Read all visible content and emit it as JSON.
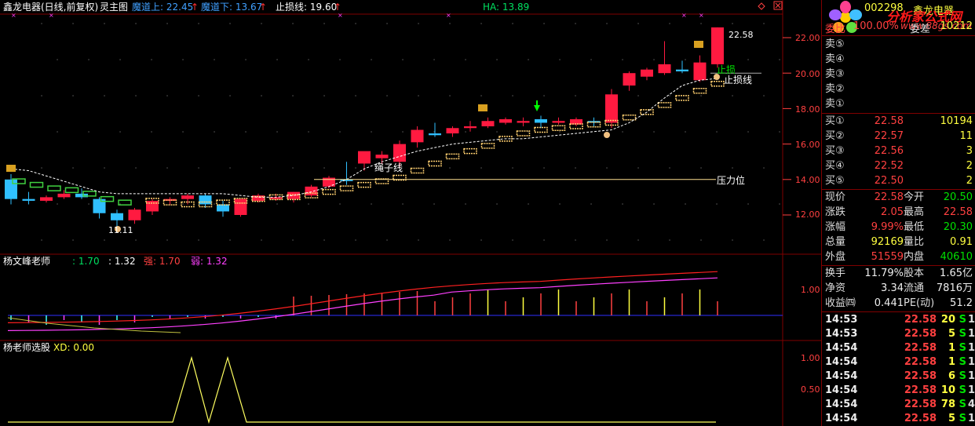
{
  "header": {
    "stock_name": "鑫龙电器(日线,前复权)",
    "main_chart": "灵主图",
    "upper_label": "魔道上: 22.45",
    "lower_label": "魔道下: 13.67",
    "stop_label": "止损线: 19.60",
    "ha_label": "HA: 13.89"
  },
  "panel2_header": {
    "title": "杨文峰老师",
    "v1": ": 1.70",
    "v2": ": 1.32",
    "strong": "强: 1.70",
    "weak": "弱: 1.32"
  },
  "panel3_header": {
    "title": "杨老师选股",
    "xd": "XD: 0.00"
  },
  "annotations": {
    "high_price": "22.58",
    "low_price": "11.11",
    "stop_text": "止损",
    "stop_line_text": "止损线",
    "pressure_text": "压力位",
    "rope_text": "绳子线"
  },
  "axis": {
    "main": [
      "22.00",
      "20.00",
      "18.00",
      "16.00",
      "14.00",
      "12.00"
    ],
    "mid": [
      "1.00"
    ],
    "low": [
      "1.00",
      "0.50"
    ]
  },
  "quote": {
    "code": "002298",
    "name": "鑫龙电器",
    "watermark": "分析家公式网",
    "watermark_url": "www.88gs.com",
    "weibi_label": "委比",
    "weibi": "100.00%",
    "weicha_label": "委差",
    "weicha": "10212",
    "sell": [
      {
        "label": "卖⑤",
        "price": "",
        "vol": ""
      },
      {
        "label": "卖④",
        "price": "",
        "vol": ""
      },
      {
        "label": "卖③",
        "price": "",
        "vol": ""
      },
      {
        "label": "卖②",
        "price": "",
        "vol": ""
      },
      {
        "label": "卖①",
        "price": "",
        "vol": ""
      }
    ],
    "buy": [
      {
        "label": "买①",
        "price": "22.58",
        "vol": "10194"
      },
      {
        "label": "买②",
        "price": "22.57",
        "vol": "11"
      },
      {
        "label": "买③",
        "price": "22.56",
        "vol": "3"
      },
      {
        "label": "买④",
        "price": "22.52",
        "vol": "2"
      },
      {
        "label": "买⑤",
        "price": "22.50",
        "vol": "2"
      }
    ],
    "stats": [
      {
        "l1": "现价",
        "v1": "22.58",
        "l2": "今开",
        "v2": "20.50"
      },
      {
        "l1": "涨跌",
        "v1": "2.05",
        "l2": "最高",
        "v2": "22.58"
      },
      {
        "l1": "涨幅",
        "v1": "9.99%",
        "l2": "最低",
        "v2": "20.30"
      },
      {
        "l1": "总量",
        "v1": "92169",
        "l2": "量比",
        "v2": "0.91"
      },
      {
        "l1": "外盘",
        "v1": "51559",
        "l2": "内盘",
        "v2": "40610"
      }
    ],
    "finance": [
      {
        "l1": "换手",
        "v1": "11.79%",
        "l2": "股本",
        "v2": "1.65亿"
      },
      {
        "l1": "净资",
        "v1": "3.34",
        "l2": "流通",
        "v2": "7816万"
      },
      {
        "l1": "收益㈣",
        "v1": "0.441",
        "l2": "PE(动)",
        "v2": "51.2"
      }
    ],
    "ticks": [
      {
        "time": "14:53",
        "price": "22.58",
        "vol": "20",
        "bs": "S",
        "n": "1"
      },
      {
        "time": "14:53",
        "price": "22.58",
        "vol": "5",
        "bs": "S",
        "n": "1"
      },
      {
        "time": "14:54",
        "price": "22.58",
        "vol": "1",
        "bs": "S",
        "n": "1"
      },
      {
        "time": "14:54",
        "price": "22.58",
        "vol": "1",
        "bs": "S",
        "n": "1"
      },
      {
        "time": "14:54",
        "price": "22.58",
        "vol": "6",
        "bs": "S",
        "n": "1"
      },
      {
        "time": "14:54",
        "price": "22.58",
        "vol": "10",
        "bs": "S",
        "n": "1"
      },
      {
        "time": "14:54",
        "price": "22.58",
        "vol": "78",
        "bs": "S",
        "n": "4"
      },
      {
        "time": "14:54",
        "price": "22.58",
        "vol": "5",
        "bs": "S",
        "n": "1"
      }
    ]
  },
  "colors": {
    "up": "#ff1a40",
    "down": "#30c0ff",
    "grid": "#800000",
    "upper_band": "#ffd070",
    "stop": "#ffffff",
    "line_red": "#ff2020",
    "line_purple": "#ff40ff",
    "line_yellow": "#ffff60"
  },
  "chart_data": {
    "type": "candlestick",
    "ylim": [
      11.0,
      23.0
    ],
    "candles": [
      {
        "o": 14.0,
        "h": 14.3,
        "l": 12.6,
        "c": 12.9,
        "up": false
      },
      {
        "o": 12.9,
        "h": 13.3,
        "l": 12.6,
        "c": 12.8,
        "up": false
      },
      {
        "o": 12.8,
        "h": 13.1,
        "l": 12.7,
        "c": 13.0,
        "up": true
      },
      {
        "o": 13.0,
        "h": 13.4,
        "l": 12.9,
        "c": 13.2,
        "up": true
      },
      {
        "o": 13.2,
        "h": 13.5,
        "l": 12.9,
        "c": 13.0,
        "up": false
      },
      {
        "o": 12.9,
        "h": 13.0,
        "l": 11.8,
        "c": 12.1,
        "up": false
      },
      {
        "o": 12.1,
        "h": 12.3,
        "l": 11.1,
        "c": 11.7,
        "up": false
      },
      {
        "o": 11.7,
        "h": 12.4,
        "l": 11.5,
        "c": 12.3,
        "up": true
      },
      {
        "o": 12.2,
        "h": 12.9,
        "l": 12.0,
        "c": 12.8,
        "up": true
      },
      {
        "o": 12.8,
        "h": 13.0,
        "l": 12.6,
        "c": 12.9,
        "up": true
      },
      {
        "o": 12.9,
        "h": 13.2,
        "l": 12.6,
        "c": 13.1,
        "up": true
      },
      {
        "o": 13.1,
        "h": 13.2,
        "l": 12.4,
        "c": 12.6,
        "up": false
      },
      {
        "o": 12.6,
        "h": 12.8,
        "l": 11.9,
        "c": 12.2,
        "up": false
      },
      {
        "o": 12.0,
        "h": 12.9,
        "l": 11.9,
        "c": 12.9,
        "up": true
      },
      {
        "o": 12.8,
        "h": 13.2,
        "l": 12.7,
        "c": 13.1,
        "up": true
      },
      {
        "o": 12.9,
        "h": 13.2,
        "l": 12.8,
        "c": 13.0,
        "up": true
      },
      {
        "o": 12.9,
        "h": 13.3,
        "l": 12.7,
        "c": 13.3,
        "up": true
      },
      {
        "o": 13.1,
        "h": 13.7,
        "l": 13.0,
        "c": 13.6,
        "up": true
      },
      {
        "o": 13.6,
        "h": 14.2,
        "l": 13.5,
        "c": 14.1,
        "up": true
      },
      {
        "o": 14.0,
        "h": 15.0,
        "l": 13.7,
        "c": 14.0,
        "up": false
      },
      {
        "o": 14.9,
        "h": 15.4,
        "l": 14.5,
        "c": 15.6,
        "up": true
      },
      {
        "o": 15.2,
        "h": 15.6,
        "l": 14.9,
        "c": 15.4,
        "up": true
      },
      {
        "o": 15.0,
        "h": 16.2,
        "l": 14.6,
        "c": 16.0,
        "up": true
      },
      {
        "o": 16.1,
        "h": 17.0,
        "l": 15.8,
        "c": 16.8,
        "up": true
      },
      {
        "o": 16.5,
        "h": 17.2,
        "l": 16.4,
        "c": 16.6,
        "up": false
      },
      {
        "o": 16.6,
        "h": 17.0,
        "l": 16.4,
        "c": 16.9,
        "up": true
      },
      {
        "o": 16.9,
        "h": 17.3,
        "l": 16.7,
        "c": 17.0,
        "up": true
      },
      {
        "o": 17.0,
        "h": 17.5,
        "l": 16.9,
        "c": 17.3,
        "up": true
      },
      {
        "o": 17.2,
        "h": 17.5,
        "l": 17.1,
        "c": 17.4,
        "up": true
      },
      {
        "o": 17.2,
        "h": 17.5,
        "l": 17.0,
        "c": 17.3,
        "up": true
      },
      {
        "o": 17.2,
        "h": 17.6,
        "l": 16.9,
        "c": 17.4,
        "up": false
      },
      {
        "o": 17.2,
        "h": 17.5,
        "l": 17.1,
        "c": 17.3,
        "up": true
      },
      {
        "o": 17.1,
        "h": 17.5,
        "l": 17.0,
        "c": 17.4,
        "up": true
      },
      {
        "o": 17.2,
        "h": 17.5,
        "l": 17.0,
        "c": 17.3,
        "up": false
      },
      {
        "o": 17.2,
        "h": 19.1,
        "l": 16.9,
        "c": 18.8,
        "up": true
      },
      {
        "o": 19.3,
        "h": 20.1,
        "l": 19.0,
        "c": 20.0,
        "up": true
      },
      {
        "o": 19.8,
        "h": 20.3,
        "l": 19.6,
        "c": 20.2,
        "up": true
      },
      {
        "o": 20.0,
        "h": 21.8,
        "l": 19.9,
        "c": 20.5,
        "up": true
      },
      {
        "o": 20.2,
        "h": 20.7,
        "l": 20.0,
        "c": 20.1,
        "up": false
      },
      {
        "o": 19.6,
        "h": 21.0,
        "l": 19.5,
        "c": 20.6,
        "up": true
      },
      {
        "o": 20.5,
        "h": 22.58,
        "l": 20.3,
        "c": 22.58,
        "up": true
      }
    ]
  }
}
